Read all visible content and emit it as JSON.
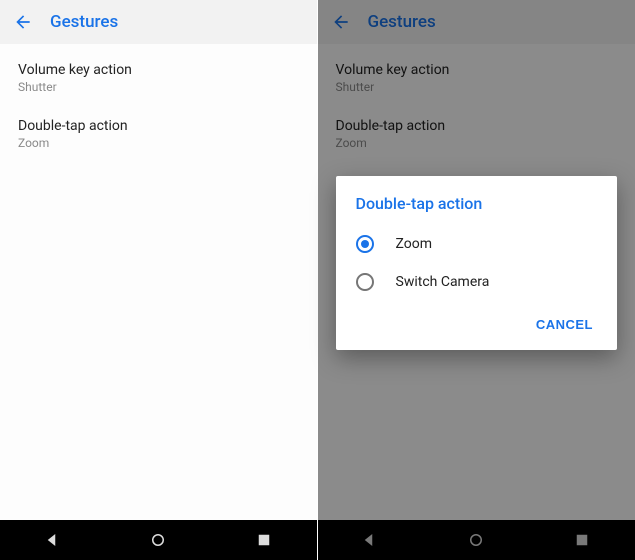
{
  "left": {
    "title": "Gestures",
    "items": [
      {
        "title": "Volume key action",
        "sub": "Shutter"
      },
      {
        "title": "Double-tap action",
        "sub": "Zoom"
      }
    ]
  },
  "right": {
    "title": "Gestures",
    "items": [
      {
        "title": "Volume key action",
        "sub": "Shutter"
      },
      {
        "title": "Double-tap action",
        "sub": "Zoom"
      }
    ],
    "dialog": {
      "title": "Double-tap action",
      "options": [
        {
          "label": "Zoom",
          "checked": true
        },
        {
          "label": "Switch Camera",
          "checked": false
        }
      ],
      "cancel": "CANCEL"
    }
  },
  "nav": {
    "back": "back-icon",
    "home": "home-icon",
    "recents": "recents-icon"
  }
}
